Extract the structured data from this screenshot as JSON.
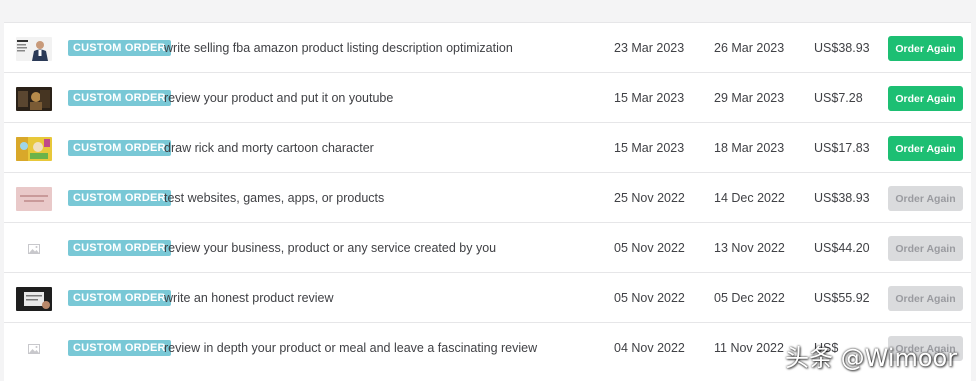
{
  "orders": [
    {
      "badge": "CUSTOM ORDER",
      "title": "write selling fba amazon product listing description optimization",
      "date_ordered": "23 Mar 2023",
      "date_delivered": "26 Mar 2023",
      "price": "US$38.93",
      "action": "Order Again",
      "action_enabled": true,
      "thumbnail": "person-photo"
    },
    {
      "badge": "CUSTOM ORDER",
      "title": "review your product and put it on youtube",
      "date_ordered": "15 Mar 2023",
      "date_delivered": "29 Mar 2023",
      "price": "US$7.28",
      "action": "Order Again",
      "action_enabled": true,
      "thumbnail": "dark-photo"
    },
    {
      "badge": "CUSTOM ORDER",
      "title": "draw rick and morty cartoon character",
      "date_ordered": "15 Mar 2023",
      "date_delivered": "18 Mar 2023",
      "price": "US$17.83",
      "action": "Order Again",
      "action_enabled": true,
      "thumbnail": "cartoon-image"
    },
    {
      "badge": "CUSTOM ORDER",
      "title": "test websites, games, apps, or products",
      "date_ordered": "25 Nov 2022",
      "date_delivered": "14 Dec 2022",
      "price": "US$38.93",
      "action": "Order Again",
      "action_enabled": false,
      "thumbnail": "pink-image"
    },
    {
      "badge": "CUSTOM ORDER",
      "title": "review your business, product or any service created by you",
      "date_ordered": "05 Nov 2022",
      "date_delivered": "13 Nov 2022",
      "price": "US$44.20",
      "action": "Order Again",
      "action_enabled": false,
      "thumbnail": "image-placeholder-icon"
    },
    {
      "badge": "CUSTOM ORDER",
      "title": "write an honest product review",
      "date_ordered": "05 Nov 2022",
      "date_delivered": "05 Dec 2022",
      "price": "US$55.92",
      "action": "Order Again",
      "action_enabled": false,
      "thumbnail": "dark-photo"
    },
    {
      "badge": "CUSTOM ORDER",
      "title": "review in depth your product or meal and leave a fascinating review",
      "date_ordered": "04 Nov 2022",
      "date_delivered": "11 Nov 2022",
      "price": "US$",
      "action": "Order Again",
      "action_enabled": false,
      "thumbnail": "image-placeholder-icon"
    }
  ],
  "watermark": "头条 @Wimoor",
  "colors": {
    "badge": "#79c8d6",
    "button_active": "#1dbf73",
    "button_disabled": "#dadbdd",
    "text": "#404145"
  }
}
